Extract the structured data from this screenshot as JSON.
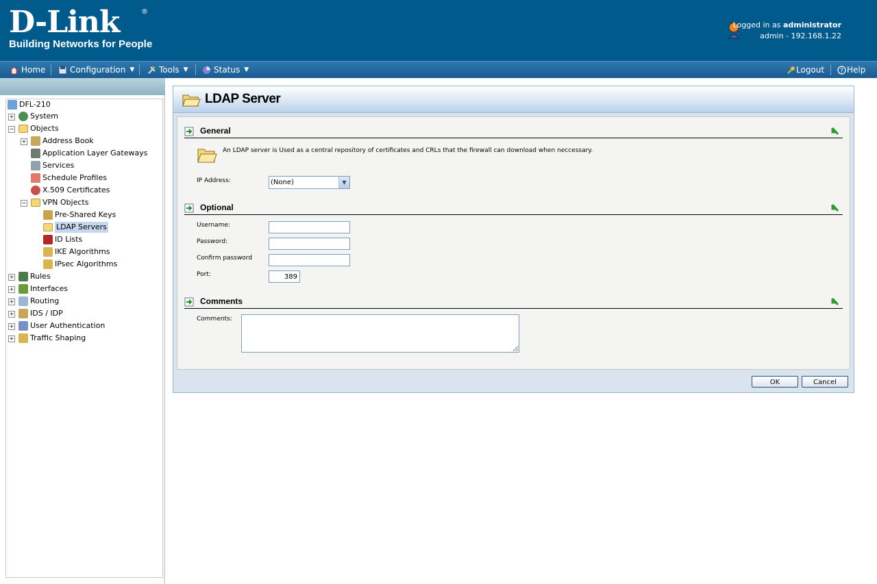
{
  "header": {
    "brand": "D-Link",
    "registered_mark": "®",
    "tagline": "Building Networks for People",
    "logged_in_prefix": "Logged in as",
    "user": "administrator",
    "session": "admin - 192.168.1.22"
  },
  "menu": {
    "home": "Home",
    "configuration": "Configuration",
    "tools": "Tools",
    "status": "Status",
    "logout": "Logout",
    "help": "Help"
  },
  "tree": {
    "root": "DFL-210",
    "items": {
      "system": "System",
      "objects": "Objects",
      "address_book": "Address Book",
      "alg": "Application Layer Gateways",
      "services": "Services",
      "schedule_profiles": "Schedule Profiles",
      "x509": "X.509 Certificates",
      "vpn_objects": "VPN Objects",
      "psk": "Pre-Shared Keys",
      "ldap_servers": "LDAP Servers",
      "id_lists": "ID Lists",
      "ike_algorithms": "IKE Algorithms",
      "ipsec_algorithms": "IPsec Algorithms",
      "rules": "Rules",
      "interfaces": "Interfaces",
      "routing": "Routing",
      "ids_idp": "IDS / IDP",
      "user_auth": "User Authentication",
      "traffic_shaping": "Traffic Shaping"
    }
  },
  "page": {
    "title": "LDAP Server",
    "general": {
      "heading": "General",
      "description": "An LDAP server is Used as a central repository of certificates and CRLs that the firewall can download when neccessary.",
      "ip_label": "IP Address:",
      "ip_value": "(None)"
    },
    "optional": {
      "heading": "Optional",
      "username_label": "Username:",
      "password_label": "Password:",
      "confirm_label": "Confirm password",
      "port_label": "Port:",
      "port_value": "389"
    },
    "comments": {
      "heading": "Comments",
      "label": "Comments:"
    },
    "ok_label": "OK",
    "cancel_label": "Cancel"
  },
  "colors": {
    "header_bg": "#005a8c",
    "menubar": "#1b5b8f",
    "panel_border": "#98b4cc"
  }
}
